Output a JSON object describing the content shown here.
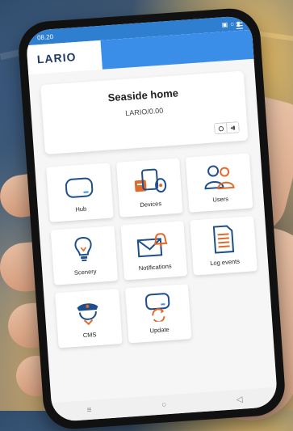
{
  "status_bar": {
    "time": "08.20",
    "signal": "▣",
    "wifi": "○",
    "battery": "▮"
  },
  "app": {
    "logo": "LARIO",
    "menu_icon": "☰"
  },
  "home": {
    "title": "Seaside home",
    "subtitle": "LARIO/0.00",
    "action_icons": [
      "power-icon",
      "exit-icon"
    ]
  },
  "tiles": [
    {
      "label": "Hub",
      "icon": "hub-icon"
    },
    {
      "label": "Devices",
      "icon": "devices-icon"
    },
    {
      "label": "Users",
      "icon": "users-icon"
    },
    {
      "label": "Scenery",
      "icon": "lightbulb-icon"
    },
    {
      "label": "Notifications",
      "icon": "notifications-icon"
    },
    {
      "label": "Log events",
      "icon": "log-icon"
    },
    {
      "label": "CMS",
      "icon": "cms-icon"
    },
    {
      "label": "Update",
      "icon": "update-icon"
    }
  ],
  "nav": {
    "menu": "≡",
    "home": "○",
    "back": "◁"
  },
  "colors": {
    "accent": "#3a8ee8",
    "orange": "#e06a2c",
    "navy": "#1f4f8a"
  }
}
